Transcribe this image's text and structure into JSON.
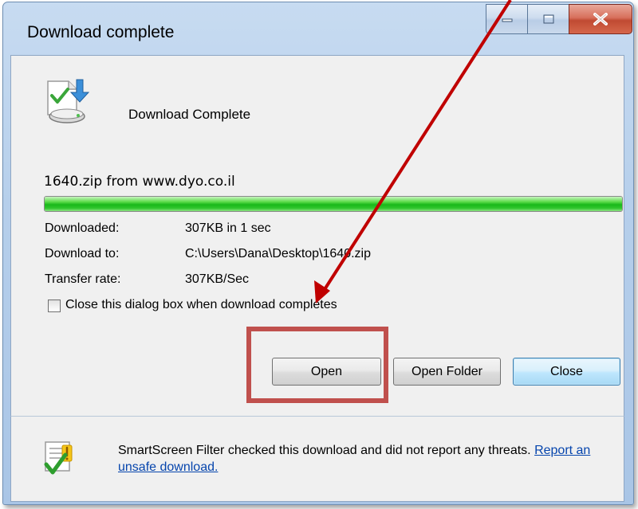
{
  "window": {
    "title": "Download complete"
  },
  "caption_buttons": {
    "minimize_icon": "minimize-icon",
    "maximize_icon": "maximize-icon",
    "close_icon": "close-x-icon"
  },
  "main": {
    "headline": "Download Complete",
    "icon": "download-complete-icon",
    "file_line": "1640.zip from www.dyo.co.il",
    "progress_fraction": 1.0,
    "details": [
      {
        "label": "Downloaded:",
        "value": "307KB in 1 sec"
      },
      {
        "label": "Download to:",
        "value": "C:\\Users\\Dana\\Desktop\\1640.zip"
      },
      {
        "label": "Transfer rate:",
        "value": "307KB/Sec"
      }
    ],
    "close_when_complete": {
      "label": "Close this dialog box when download completes",
      "checked": false
    }
  },
  "buttons": {
    "open": "Open",
    "open_folder": "Open Folder",
    "close": "Close"
  },
  "footer": {
    "icon": "smartscreen-shield-icon",
    "text_prefix": "SmartScreen Filter checked this download and did not report any threats. ",
    "link": "Report an unsafe download."
  },
  "annotations": {
    "highlight_color": "#c0504d",
    "arrow_color": "#c00000"
  },
  "colors": {
    "progress_green": "#19b81a",
    "link_blue": "#0645ad"
  }
}
